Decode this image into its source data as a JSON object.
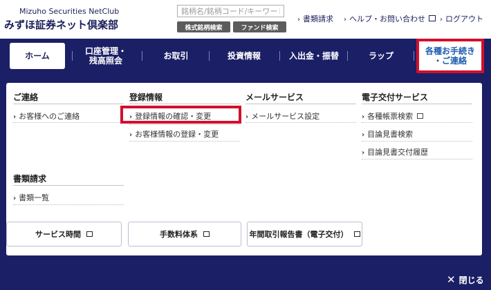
{
  "header": {
    "brand_en": "Mizuho Securities NetClub",
    "brand_ja": "みずほ証券ネット倶楽部",
    "search_placeholder": "銘柄名/銘柄コード/キーワード",
    "stock_search": "株式銘柄検索",
    "fund_search": "ファンド検索",
    "links": {
      "documents": "書類請求",
      "help": "ヘルプ・お問い合わせ",
      "logout": "ログアウト"
    }
  },
  "nav": {
    "home": "ホーム",
    "account_1": "口座管理・",
    "account_2": "残高照会",
    "trade": "お取引",
    "invest_info": "投資情報",
    "deposit": "入出金・振替",
    "wrap": "ラップ",
    "procedures_1": "各種お手続き",
    "procedures_2": "・ご連絡"
  },
  "panel": {
    "contact": {
      "heading": "ご連絡",
      "items": [
        "お客様へのご連絡"
      ]
    },
    "registration": {
      "heading": "登録情報",
      "items": [
        "登録情報の確認・変更",
        "お客様情報の登録・変更"
      ]
    },
    "mail": {
      "heading": "メールサービス",
      "items": [
        "メールサービス設定"
      ]
    },
    "edelivery": {
      "heading": "電子交付サービス",
      "items": [
        "各種帳票検索",
        "目論見書検索",
        "目論見書交付履歴"
      ]
    },
    "docs": {
      "heading": "書類請求",
      "items": [
        "書類一覧"
      ]
    }
  },
  "buttons": {
    "service_hours": "サービス時間",
    "fees": "手数料体系",
    "annual_report": "年間取引報告書（電子交付）"
  },
  "close_label": "閉じる",
  "colors": {
    "nav_bg": "#1b1f66",
    "brand": "#1b1f5a",
    "highlight": "#d1102d",
    "procedures_text": "#1b5cb0"
  },
  "icons": [
    "chevron-right-icon",
    "external-window-icon",
    "close-icon"
  ]
}
